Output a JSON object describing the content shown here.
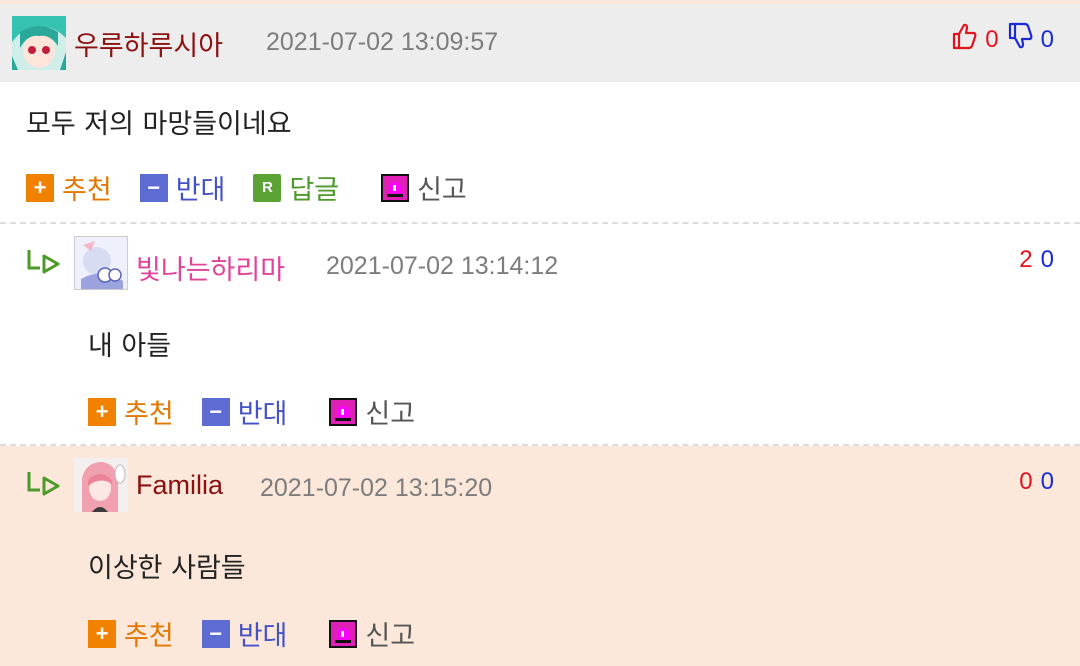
{
  "comments": [
    {
      "nickname": "우루하루시아",
      "timestamp": "2021-07-02 13:09:57",
      "text": "모두 저의 마망들이네요",
      "likes": "0",
      "dislikes": "0",
      "nick_color": "#8b1010"
    },
    {
      "nickname": "빛나는하리마",
      "timestamp": "2021-07-02 13:14:12",
      "text": "내 아들",
      "likes": "2",
      "dislikes": "0",
      "nick_color": "#e0439a"
    },
    {
      "nickname": "Familia",
      "timestamp": "2021-07-02 13:15:20",
      "text": "이상한 사람들",
      "likes": "0",
      "dislikes": "0",
      "nick_color": "#8b1010"
    }
  ],
  "actions": {
    "recommend": "추천",
    "oppose": "반대",
    "reply": "답글",
    "report": "신고",
    "reply_badge": "R"
  },
  "colors": {
    "recommend": "#f08200",
    "oppose": "#5e6bd2",
    "reply": "#5aa334",
    "report": "#e01fb7",
    "like": "#e0141e",
    "dislike": "#1b2bd4"
  }
}
